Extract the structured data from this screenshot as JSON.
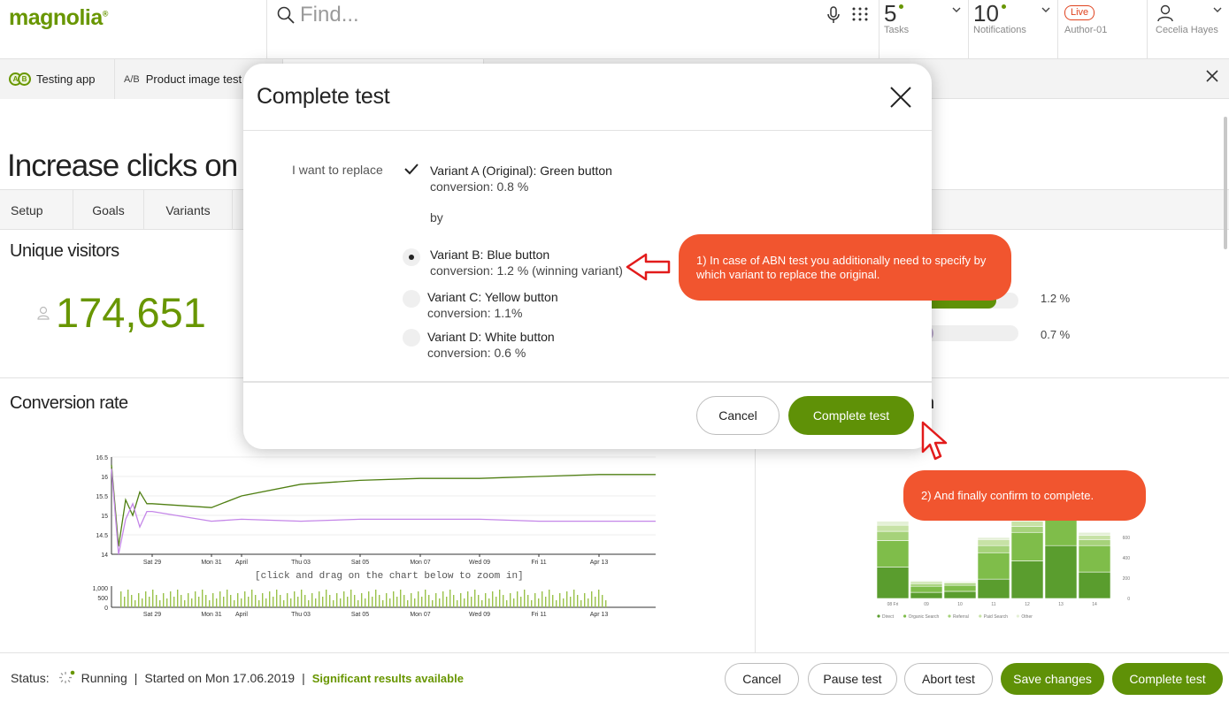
{
  "app": {
    "logo": "magnolia",
    "logo_mark": "®"
  },
  "topbar": {
    "search_placeholder": "Find...",
    "tasks": {
      "count": "5",
      "label": "Tasks"
    },
    "notifications": {
      "count": "10",
      "label": "Notifications"
    },
    "environment": {
      "badge": "Live",
      "label": "Author-01"
    },
    "user": {
      "name": "Cecelia Hayes"
    }
  },
  "tabs": [
    {
      "label": "Testing app"
    },
    {
      "label": "Product image test"
    }
  ],
  "page": {
    "title": "Increase clicks on C",
    "subtabs": [
      "Setup",
      "Goals",
      "Variants"
    ],
    "unique_visitors": {
      "title": "Unique visitors",
      "value": "174,651"
    },
    "conversion_rate": {
      "title": "Conversion rate"
    },
    "right_panel_suffix": "n",
    "bars": [
      {
        "value": "1.2 %",
        "fraction": 0.85,
        "color": "#5f9107"
      },
      {
        "value": "0.7 %",
        "fraction": 0.42,
        "color": "#b7a5c8"
      }
    ]
  },
  "chart_data": [
    {
      "type": "line",
      "title": "",
      "xlabel": "",
      "ylabel": "",
      "x": [
        "Sat 29",
        "Mon 31",
        "April",
        "Thu 03",
        "Sat 05",
        "Mon 07",
        "Wed 09",
        "Fri 11",
        "Apr 13"
      ],
      "y_ticks": [
        "14",
        "14.5",
        "15",
        "15.5",
        "16",
        "16.5"
      ],
      "ylim": [
        14,
        16.5
      ],
      "series": [
        {
          "values": [
            15.3,
            15.2,
            15.5,
            15.8,
            15.9,
            15.95,
            15.95,
            16.0,
            16.05
          ],
          "color": "#4f7f12"
        },
        {
          "values": [
            15.1,
            14.85,
            14.9,
            14.85,
            14.9,
            14.9,
            14.9,
            14.85,
            14.85
          ],
          "color": "#c486e8"
        }
      ],
      "zoom_hint": "[click and drag on the chart below to zoom in]"
    },
    {
      "type": "bar",
      "title": "",
      "y_ticks": [
        "0",
        "500",
        "1,000"
      ],
      "ylim": [
        0,
        1000
      ],
      "x": [
        "Sat 29",
        "Mon 31",
        "April",
        "Thu 03",
        "Sat 05",
        "Mon 07",
        "Wed 09",
        "Fri 11",
        "Apr 13"
      ],
      "color": "#9ac24a"
    },
    {
      "type": "bar",
      "title": "",
      "categories": [
        "08 Fri",
        "09",
        "10",
        "11",
        "12",
        "13",
        "14"
      ],
      "y_ticks": [
        "0",
        "200",
        "400",
        "600"
      ],
      "legend": [
        "Direct",
        "Organic Search",
        "Referral",
        "Paid Search",
        "Other"
      ],
      "series": [
        {
          "name": "Direct",
          "values": [
            310,
            60,
            70,
            190,
            370,
            520,
            260
          ]
        },
        {
          "name": "Organic Search",
          "values": [
            260,
            60,
            60,
            260,
            280,
            330,
            260
          ]
        },
        {
          "name": "Referral",
          "values": [
            90,
            25,
            20,
            70,
            60,
            60,
            60
          ]
        },
        {
          "name": "Paid Search",
          "values": [
            60,
            20,
            10,
            60,
            50,
            60,
            40
          ]
        },
        {
          "name": "Other",
          "values": [
            40,
            10,
            10,
            20,
            30,
            30,
            30
          ]
        }
      ]
    }
  ],
  "dialog": {
    "title": "Complete test",
    "replace_label": "I want to replace",
    "original": {
      "name": "Variant A (Original): Green button",
      "conversion": "conversion: 0.8 %",
      "checked": true
    },
    "by_label": "by",
    "variants": [
      {
        "name": "Variant B: Blue button",
        "conversion": "conversion: 1.2 % (winning variant)",
        "selected": true
      },
      {
        "name": "Variant C: Yellow button",
        "conversion": "conversion: 1.1%",
        "selected": false
      },
      {
        "name": "Variant D: White button",
        "conversion": "conversion: 0.6 %",
        "selected": false
      }
    ],
    "cancel_label": "Cancel",
    "confirm_label": "Complete test"
  },
  "callouts": [
    {
      "text": "1) In case of ABN test you additionally need to specify by which variant to replace the original."
    },
    {
      "text": "2) And finally confirm to complete."
    }
  ],
  "footer": {
    "status_label": "Status:",
    "status_value": "Running",
    "started": "Started on Mon 17.06.2019",
    "significant": "Significant results available",
    "buttons": {
      "cancel": "Cancel",
      "pause": "Pause test",
      "abort": "Abort test",
      "save": "Save changes",
      "complete": "Complete test"
    }
  },
  "colors": {
    "accent": "#5f9107",
    "callout": "#f1552f",
    "live": "#e0431f"
  }
}
